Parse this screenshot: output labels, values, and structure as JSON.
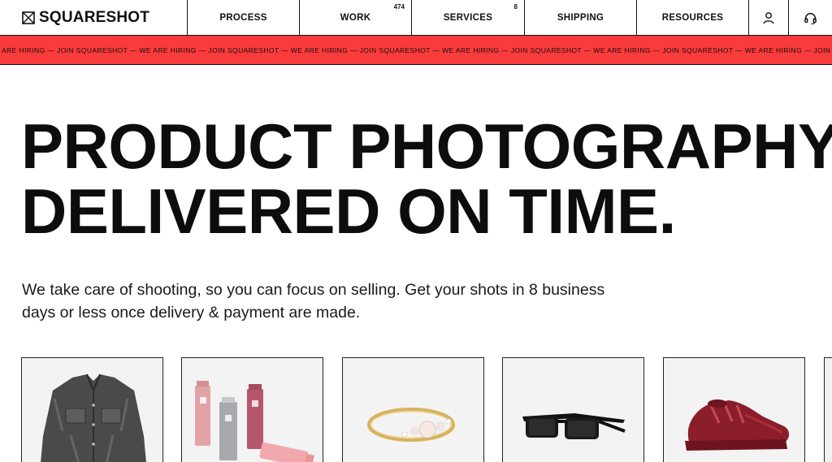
{
  "header": {
    "logo_text": "SQUARESHOT",
    "nav": [
      {
        "label": "PROCESS",
        "count": ""
      },
      {
        "label": "WORK",
        "count": "474"
      },
      {
        "label": "SERVICES",
        "count": "8"
      },
      {
        "label": "SHIPPING",
        "count": ""
      },
      {
        "label": "RESOURCES",
        "count": ""
      }
    ],
    "icons": [
      "user-icon",
      "headset-icon"
    ]
  },
  "banner": {
    "text": "ARE HIRING — JOIN SQUARESHOT — WE ARE HIRING — JOIN SQUARESHOT — WE ARE HIRING — JOIN SQUARESHOT — WE ARE HIRING — JOIN SQUARESHOT — WE ARE HIRING — JOIN SQUARESHOT — WE ARE HIRING — JOIN SQUARESHOT — WE ARE HIRING — JOIN SQUARESHOT — WE ARE HIRING — JOIN SQUARES"
  },
  "hero": {
    "title_line1": "PRODUCT PHOTOGRAPHY",
    "title_line2": "DELIVERED ON TIME.",
    "subtitle": "We take care of shooting, so you can focus on selling. Get your shots in 8 business days or less once delivery & payment are made."
  },
  "products": [
    {
      "name": "denim-jacket"
    },
    {
      "name": "cosmetic-tubes"
    },
    {
      "name": "gold-ring"
    },
    {
      "name": "sunglasses"
    },
    {
      "name": "red-sneaker"
    }
  ],
  "colors": {
    "banner_bg": "#fa3b3b",
    "text": "#111111",
    "card_bg": "#f2f2f2"
  }
}
